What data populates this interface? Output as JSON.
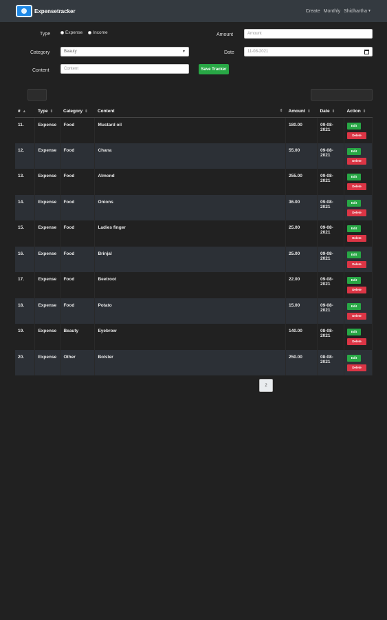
{
  "navbar": {
    "brand": "Expensetracker",
    "links": [
      "Create",
      "Monthly"
    ],
    "user": "Shidhartha"
  },
  "form": {
    "type_label": "Type",
    "type_options": [
      "Expense",
      "Income"
    ],
    "category_label": "Category",
    "category_value": "Beauty",
    "content_label": "Content",
    "content_placeholder": "Content",
    "amount_label": "Amount",
    "amount_placeholder": "Amount",
    "date_label": "Date",
    "date_value": "11-08-2021",
    "save_label": "Save Tracker"
  },
  "table": {
    "headers": [
      "#",
      "Type",
      "Category",
      "Content",
      "Amount",
      "Date",
      "Action"
    ],
    "edit_label": "Edit",
    "delete_label": "Delete",
    "rows": [
      {
        "id": "11.",
        "type": "Expense",
        "category": "Food",
        "content": "Mustard oil",
        "amount": "180.00",
        "date": "09-08-2021"
      },
      {
        "id": "12.",
        "type": "Expense",
        "category": "Food",
        "content": "Chana",
        "amount": "55.00",
        "date": "09-08-2021"
      },
      {
        "id": "13.",
        "type": "Expense",
        "category": "Food",
        "content": "Almond",
        "amount": "255.00",
        "date": "09-08-2021"
      },
      {
        "id": "14.",
        "type": "Expense",
        "category": "Food",
        "content": "Onions",
        "amount": "36.00",
        "date": "09-08-2021"
      },
      {
        "id": "15.",
        "type": "Expense",
        "category": "Food",
        "content": "Ladies finger",
        "amount": "25.00",
        "date": "09-08-2021"
      },
      {
        "id": "16.",
        "type": "Expense",
        "category": "Food",
        "content": "Brinjal",
        "amount": "25.00",
        "date": "09-08-2021"
      },
      {
        "id": "17.",
        "type": "Expense",
        "category": "Food",
        "content": "Beetroot",
        "amount": "22.00",
        "date": "09-08-2021"
      },
      {
        "id": "18.",
        "type": "Expense",
        "category": "Food",
        "content": "Potato",
        "amount": "15.00",
        "date": "09-08-2021"
      },
      {
        "id": "19.",
        "type": "Expense",
        "category": "Beauty",
        "content": "Eyebrow",
        "amount": "140.00",
        "date": "08-08-2021"
      },
      {
        "id": "20.",
        "type": "Expense",
        "category": "Other",
        "content": "Bolster",
        "amount": "250.00",
        "date": "08-08-2021"
      }
    ]
  },
  "pagination": {
    "current": "2"
  },
  "colors": {
    "navbar": "#343a40",
    "background": "#212121",
    "success": "#28a745",
    "danger": "#dc3545"
  }
}
